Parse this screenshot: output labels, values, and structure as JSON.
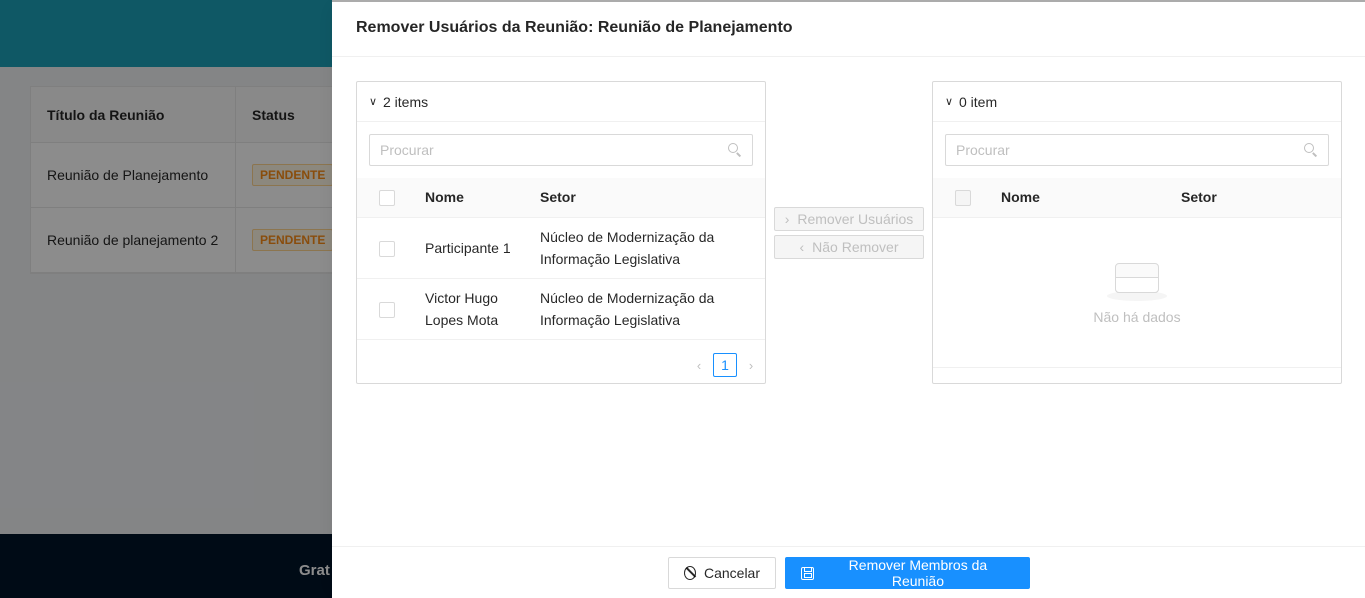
{
  "background": {
    "table_headers": [
      "Título da Reunião",
      "Status"
    ],
    "rows": [
      {
        "title": "Reunião de Planejamento",
        "status": "PENDENTE"
      },
      {
        "title": "Reunião de planejamento 2",
        "status": "PENDENTE"
      }
    ],
    "footer_text": "Grat"
  },
  "drawer": {
    "title": "Remover Usuários da Reunião: Reunião de Planejamento"
  },
  "left_list": {
    "count_label": "2 items",
    "search_placeholder": "Procurar",
    "col_name": "Nome",
    "col_sector": "Setor",
    "rows": [
      {
        "name": "Participante 1",
        "sector": "Núcleo de Modernização da Informação Legislativa"
      },
      {
        "name": "Victor Hugo Lopes Mota",
        "sector": "Núcleo de Modernização da Informação Legislativa"
      }
    ],
    "page": "1"
  },
  "right_list": {
    "count_label": "0 item",
    "search_placeholder": "Procurar",
    "col_name": "Nome",
    "col_sector": "Setor",
    "empty_text": "Não há dados"
  },
  "operations": {
    "move_right": "Remover Usuários",
    "move_left": "Não Remover"
  },
  "footer": {
    "cancel": "Cancelar",
    "submit": "Remover Membros da Reunião"
  },
  "colors": {
    "primary": "#1890ff",
    "header_teal": "#1da1b9",
    "tag_orange": "#fa8c16"
  }
}
